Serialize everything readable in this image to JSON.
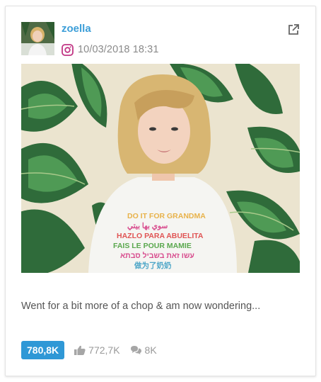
{
  "post": {
    "username": "zoella",
    "timestamp": "10/03/2018 18:31",
    "caption": "Went for a bit more of a chop & am now wondering...",
    "platform_icon": "instagram-icon",
    "shirt_lines": [
      "DO IT FOR GRANDMA",
      "سوي بها بيتي",
      "HAZLO PARA ABUELITA",
      "FAIS LE POUR MAMIE",
      "עשו זאת בשביל סבתא",
      "做为了奶奶"
    ]
  },
  "stats": {
    "reach": "780,8K",
    "likes": "772,7K",
    "comments": "8K"
  },
  "colors": {
    "accent": "#3c9ed8",
    "badge": "#2f98d6",
    "instagram": "#c13584",
    "muted": "#9a9a9a"
  }
}
